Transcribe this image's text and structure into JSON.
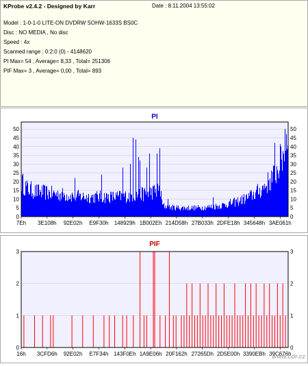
{
  "header": {
    "title": "KProbe v2.4.2 - Designed by Karr",
    "date": "Date : 8.11.2004 13:55:02",
    "model": "Model : 1-0-1-0 LITE-ON DVDRW SOHW-1633S BS0C",
    "disc": "Disc : NO MEDIA , No disc",
    "speed": "Speed : 4x",
    "scanned_range": "Scanned range : 0:2:0 (0) - 4148620",
    "pi_stats": "PI Max= 54 , Average= 8,33 , Total= 251306",
    "pif_stats": "PIF Max= 3 , Average= 0,00 , Total= 893"
  },
  "watermark": "www.cdr.cz",
  "colors": {
    "bar": "#0000ff",
    "pif_bar": "#ff0000",
    "plot_bg": "#f0f0ff",
    "title": "#0000cc",
    "pif_title": "#cc0000",
    "grid": "#c8c8c8"
  },
  "chart_data": [
    {
      "type": "bar",
      "title": "PI",
      "ylim": [
        0,
        54
      ],
      "yticks": [
        "0",
        "5",
        "10",
        "15",
        "20",
        "25",
        "30",
        "35",
        "40",
        "45",
        "50"
      ],
      "xticks": [
        "7Eh",
        "3E108h",
        "92E02h",
        "E9F30h",
        "148929h",
        "1B002Eh",
        "214D58h",
        "27B033h",
        "2DFE18h",
        "345648h",
        "3AE061h"
      ],
      "grid": true,
      "legend": "none",
      "profile": [
        [
          0.0,
          22
        ],
        [
          0.02,
          18
        ],
        [
          0.05,
          16
        ],
        [
          0.1,
          15
        ],
        [
          0.15,
          14
        ],
        [
          0.2,
          13
        ],
        [
          0.25,
          12.5
        ],
        [
          0.3,
          12.5
        ],
        [
          0.35,
          12.5
        ],
        [
          0.4,
          13
        ],
        [
          0.45,
          14
        ],
        [
          0.5,
          16
        ],
        [
          0.52,
          17
        ],
        [
          0.53,
          7
        ],
        [
          0.55,
          6
        ],
        [
          0.6,
          5.5
        ],
        [
          0.65,
          5.5
        ],
        [
          0.7,
          6
        ],
        [
          0.75,
          7
        ],
        [
          0.8,
          9
        ],
        [
          0.85,
          12
        ],
        [
          0.9,
          17
        ],
        [
          0.95,
          26
        ],
        [
          0.98,
          38
        ],
        [
          1.0,
          54
        ]
      ],
      "spikes": [
        [
          0.2,
          22
        ],
        [
          0.3,
          24
        ],
        [
          0.38,
          28
        ],
        [
          0.41,
          30
        ],
        [
          0.42,
          45
        ],
        [
          0.43,
          44
        ],
        [
          0.44,
          34
        ],
        [
          0.445,
          32
        ],
        [
          0.47,
          28
        ],
        [
          0.48,
          36
        ],
        [
          0.5,
          30
        ],
        [
          0.51,
          36
        ],
        [
          0.52,
          39
        ],
        [
          0.55,
          10
        ],
        [
          0.72,
          11
        ],
        [
          0.95,
          42
        ],
        [
          0.99,
          50
        ]
      ]
    },
    {
      "type": "bar",
      "title": "PIF",
      "ylim": [
        0,
        3
      ],
      "yticks": [
        "0",
        "1",
        "2",
        "3"
      ],
      "xticks": [
        "16h",
        "3CFD6h",
        "92E02h",
        "E7F34h",
        "143F0Eh",
        "1A9E06h",
        "20F162h",
        "27265Dh",
        "2D5E00h",
        "3390EBh",
        "39C676h"
      ],
      "grid": true,
      "legend": "none",
      "events": [
        [
          0.01,
          1
        ],
        [
          0.05,
          1
        ],
        [
          0.08,
          1
        ],
        [
          0.11,
          1
        ],
        [
          0.12,
          1
        ],
        [
          0.19,
          1
        ],
        [
          0.23,
          1
        ],
        [
          0.27,
          1
        ],
        [
          0.31,
          1
        ],
        [
          0.33,
          1
        ],
        [
          0.35,
          1
        ],
        [
          0.38,
          1
        ],
        [
          0.395,
          1
        ],
        [
          0.42,
          1
        ],
        [
          0.445,
          3
        ],
        [
          0.46,
          1
        ],
        [
          0.47,
          1
        ],
        [
          0.495,
          3
        ],
        [
          0.5,
          3
        ],
        [
          0.52,
          1
        ],
        [
          0.54,
          1
        ],
        [
          0.555,
          3
        ],
        [
          0.57,
          1
        ],
        [
          0.58,
          1
        ],
        [
          0.6,
          1
        ],
        [
          0.61,
          1
        ],
        [
          0.62,
          2
        ],
        [
          0.63,
          1
        ],
        [
          0.64,
          2
        ],
        [
          0.65,
          1
        ],
        [
          0.66,
          1
        ],
        [
          0.67,
          2
        ],
        [
          0.68,
          1
        ],
        [
          0.69,
          1
        ],
        [
          0.7,
          2
        ],
        [
          0.71,
          1
        ],
        [
          0.72,
          1
        ],
        [
          0.73,
          2
        ],
        [
          0.74,
          1
        ],
        [
          0.75,
          1
        ],
        [
          0.76,
          2
        ],
        [
          0.77,
          1
        ],
        [
          0.78,
          1
        ],
        [
          0.79,
          1
        ],
        [
          0.8,
          2
        ],
        [
          0.81,
          1
        ],
        [
          0.82,
          1
        ],
        [
          0.83,
          1
        ],
        [
          0.84,
          2
        ],
        [
          0.85,
          1
        ],
        [
          0.86,
          2
        ],
        [
          0.87,
          1
        ],
        [
          0.88,
          2
        ],
        [
          0.89,
          1
        ],
        [
          0.9,
          1
        ],
        [
          0.91,
          2
        ],
        [
          0.92,
          1
        ],
        [
          0.93,
          2
        ],
        [
          0.94,
          1
        ],
        [
          0.95,
          1
        ],
        [
          0.96,
          2
        ],
        [
          0.97,
          1
        ],
        [
          0.98,
          2
        ],
        [
          0.99,
          1
        ]
      ]
    }
  ]
}
